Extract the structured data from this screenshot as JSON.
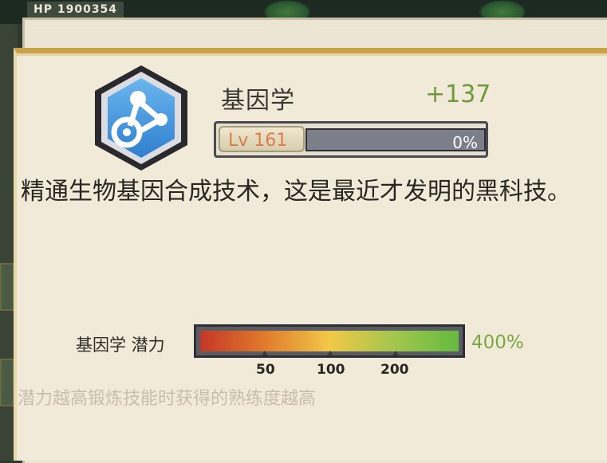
{
  "background": {
    "hp_text": "HP   1900354"
  },
  "skill": {
    "icon": "molecule-icon",
    "name": "基因学",
    "bonus": "+137",
    "level_label": "Lv 161",
    "progress_text": "0%",
    "progress": 0.0,
    "description": "精通生物基因合成技术，这是最近才发明的黑科技。"
  },
  "potential": {
    "label": "基因学 潜力",
    "value_text": "400%",
    "ticks": [
      "50",
      "100",
      "200"
    ],
    "hint": "潜力越高锻炼技能时获得的熟练度越高"
  },
  "colors": {
    "bonus": "#6f9a3c",
    "level": "#e07a4a",
    "potential": "#7aa840",
    "icon_blue": "#3b8fd8"
  }
}
